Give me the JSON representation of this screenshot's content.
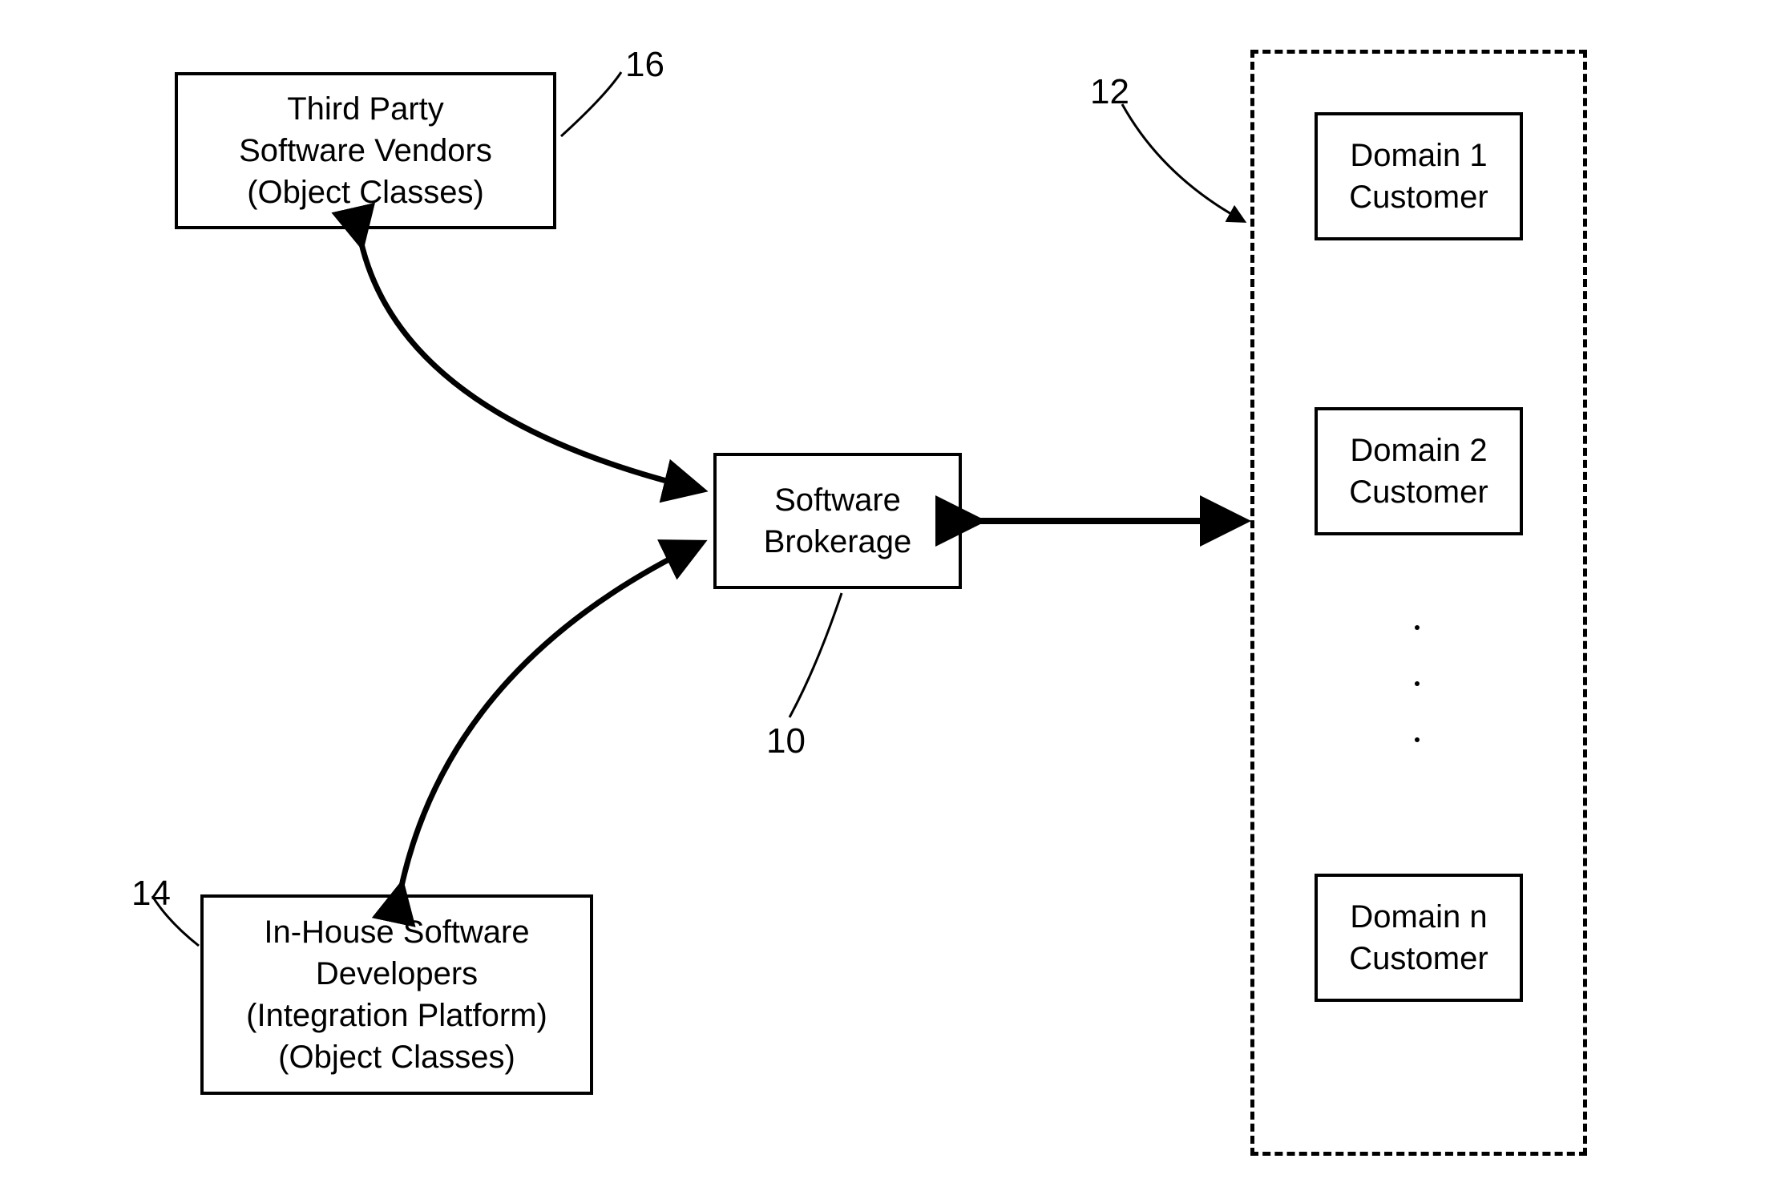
{
  "boxes": {
    "third_party": {
      "line1": "Third Party",
      "line2": "Software Vendors",
      "line3": "(Object Classes)"
    },
    "in_house": {
      "line1": "In-House Software",
      "line2": "Developers",
      "line3": "(Integration Platform)",
      "line4": "(Object Classes)"
    },
    "brokerage": {
      "line1": "Software",
      "line2": "Brokerage"
    },
    "domain1": {
      "line1": "Domain 1",
      "line2": "Customer"
    },
    "domain2": {
      "line1": "Domain 2",
      "line2": "Customer"
    },
    "domainn": {
      "line1": "Domain n",
      "line2": "Customer"
    }
  },
  "labels": {
    "l16": "16",
    "l14": "14",
    "l10": "10",
    "l12": "12"
  }
}
